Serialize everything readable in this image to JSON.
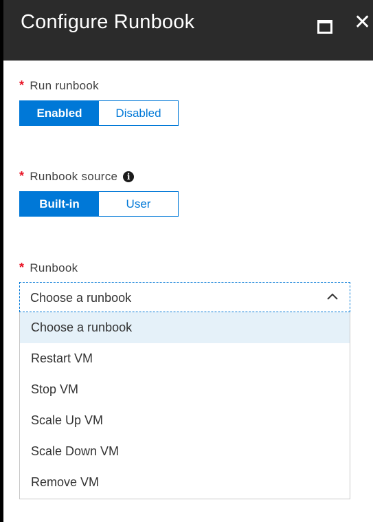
{
  "header": {
    "title": "Configure Runbook",
    "maximize_icon": "maximize-icon",
    "close_glyph": "✕"
  },
  "run_runbook": {
    "required_marker": "*",
    "label": "Run runbook",
    "options": [
      "Enabled",
      "Disabled"
    ],
    "selected": "Enabled"
  },
  "runbook_source": {
    "required_marker": "*",
    "label": "Runbook source",
    "info_glyph": "i",
    "options": [
      "Built-in",
      "User"
    ],
    "selected": "Built-in"
  },
  "runbook": {
    "required_marker": "*",
    "label": "Runbook",
    "value": "Choose a runbook",
    "options": [
      "Choose a runbook",
      "Restart VM",
      "Stop VM",
      "Scale Up VM",
      "Scale Down VM",
      "Remove VM"
    ],
    "highlighted": "Choose a runbook"
  },
  "colors": {
    "accent": "#0078d7",
    "header_bg": "#2b2b2b",
    "required": "#e81123",
    "highlight": "#e5f1f9"
  }
}
